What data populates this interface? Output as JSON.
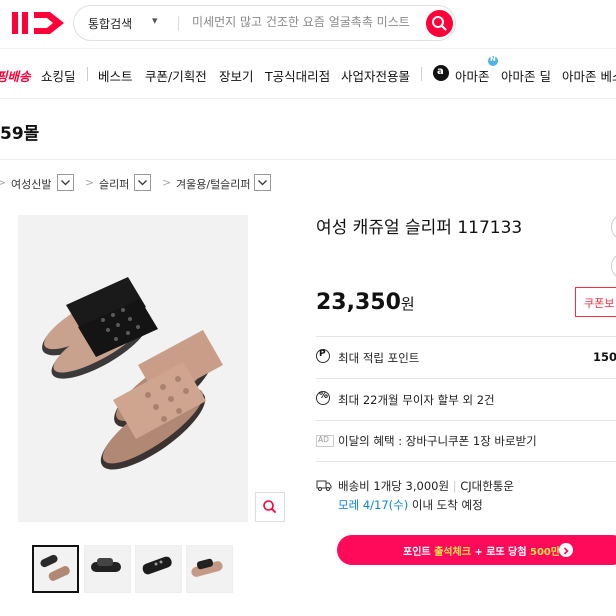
{
  "header": {
    "logo_text": "11",
    "search": {
      "category": "통합검색",
      "placeholder": "미세먼지 많고 건조한 요즘 얼굴촉촉 미스트"
    }
  },
  "gnb": {
    "items": [
      {
        "label": "핑배송"
      },
      {
        "label": "쇼킹딜"
      },
      {
        "label": "베스트"
      },
      {
        "label": "쿠폰/기획전"
      },
      {
        "label": "장보기"
      },
      {
        "label": "T공식대리점"
      },
      {
        "label": "사업자전용몰"
      },
      {
        "label": "아마존"
      },
      {
        "label": "아마존 딜"
      },
      {
        "label": "아마존 베스"
      }
    ],
    "amazon_logo_letter": "a",
    "new_badge": "N"
  },
  "store": {
    "name": "59몰"
  },
  "breadcrumb": [
    "여성신발",
    "슬리퍼",
    "겨울용/털슬리퍼"
  ],
  "product": {
    "title": "여성 캐쥬얼 슬리퍼 117133",
    "price": "23,350",
    "price_unit": "원",
    "coupon_label": "쿠폰보",
    "points": {
      "label": "최대 적립 포인트",
      "value": "150"
    },
    "installment": "최대 22개월 무이자 할부 외 2건",
    "monthly_benefit": {
      "ad": "AD",
      "text": "이달의 혜택 : 장바구니쿠폰 1장 바로받기"
    },
    "shipping": {
      "fee": "배송비 1개당 3,000원",
      "carrier": "CJ대한통운",
      "arrival_date": "모레 4/17(수)",
      "arrival_suffix": "이내 도착 예정"
    },
    "event": {
      "part1": "포인트 ",
      "highlight1": "출석체크",
      "part2": " + 로또 당첨 ",
      "highlight2": "500만P"
    }
  },
  "colors": {
    "brand_red": "#ff0038",
    "event_pink": "#ff0a5a",
    "coupon_border": "#f43142",
    "link_blue": "#0b83e6"
  }
}
